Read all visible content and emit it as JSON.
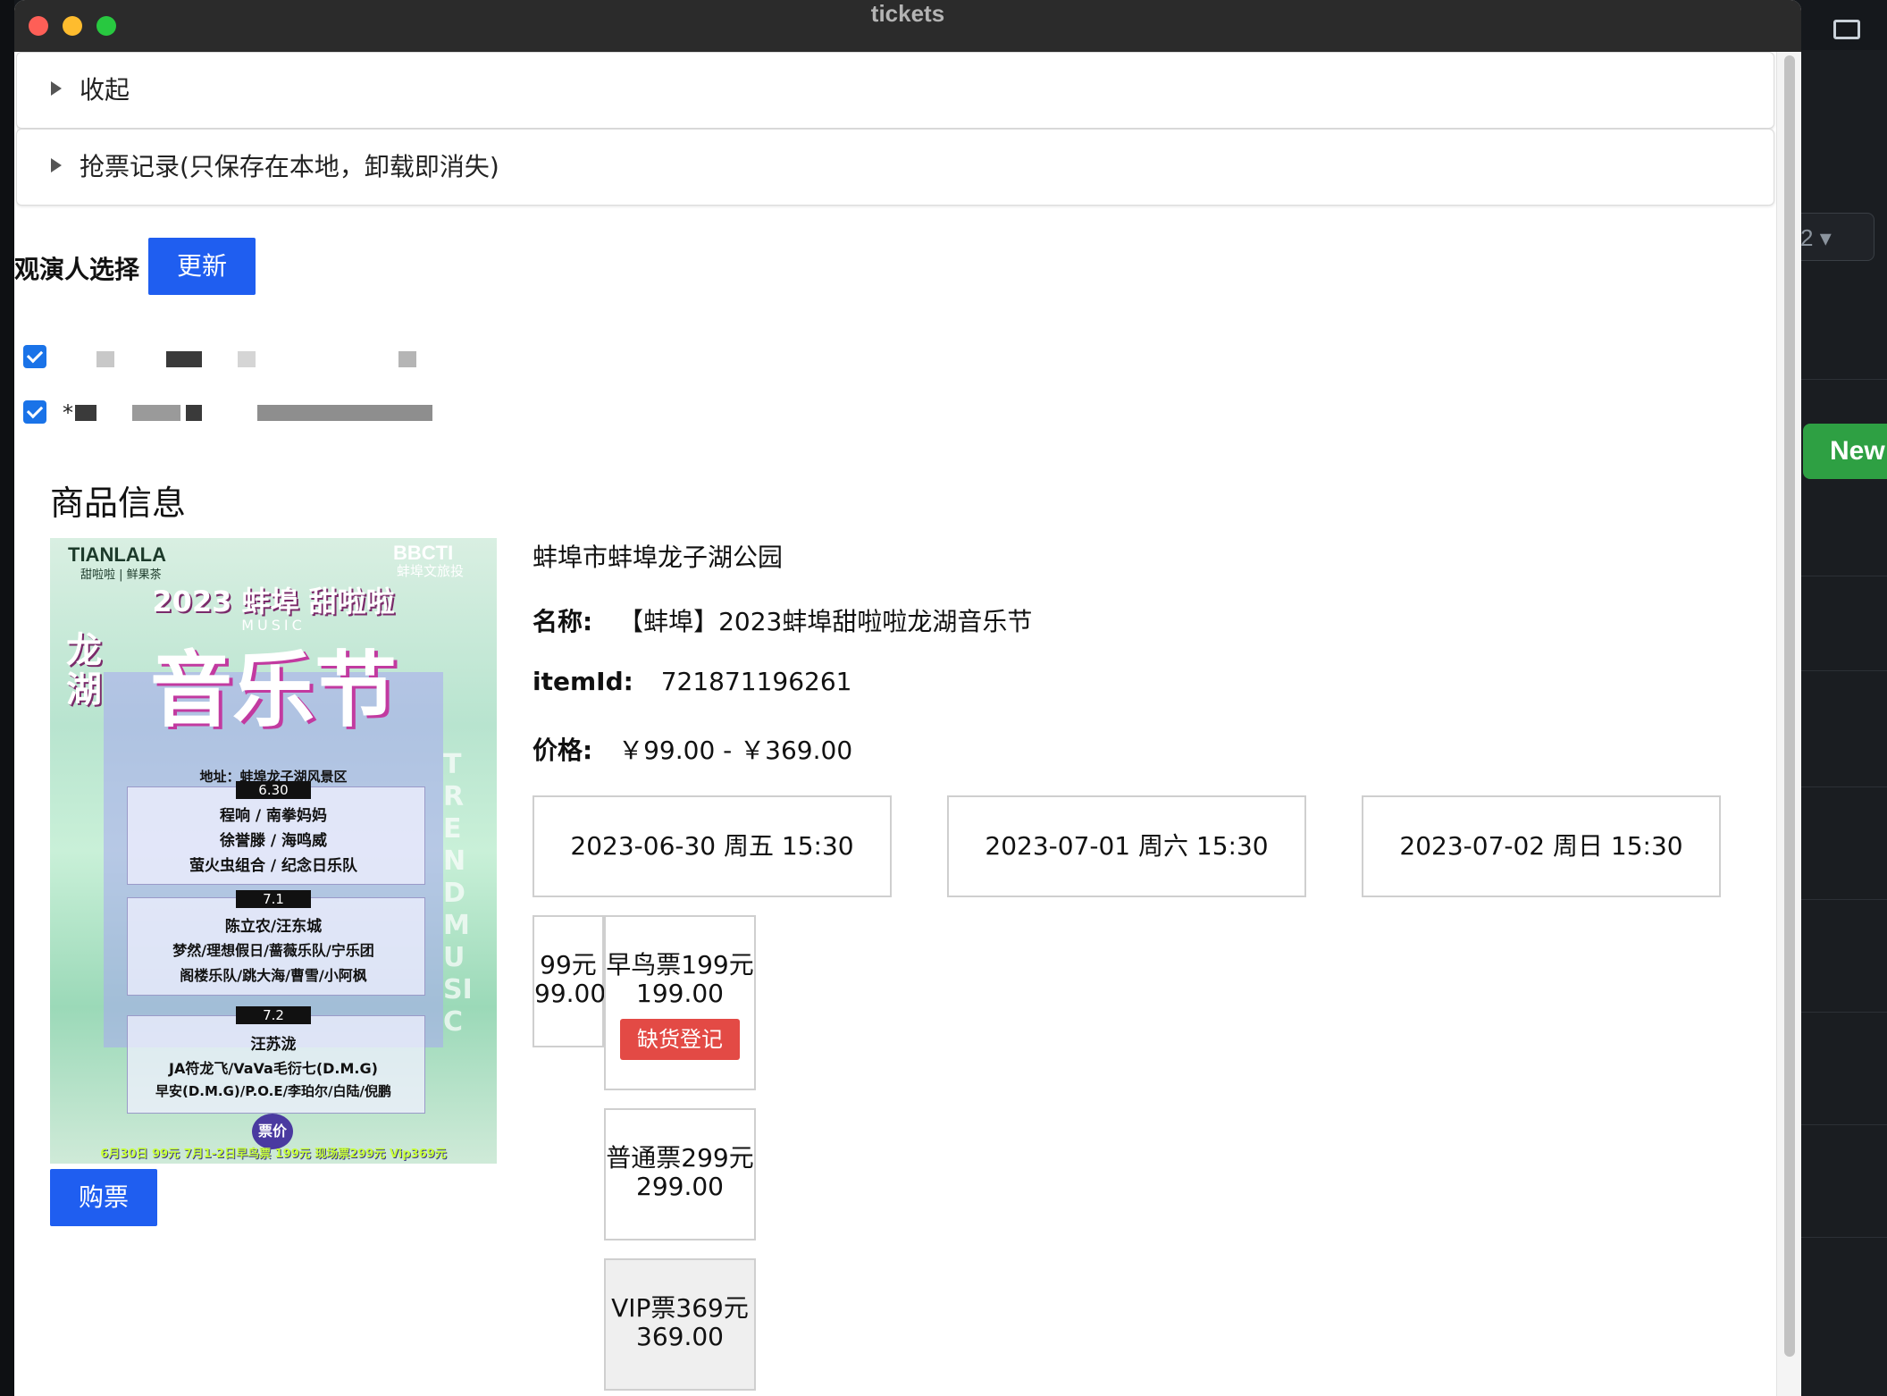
{
  "window": {
    "title": "tickets"
  },
  "background": {
    "new_button": "New",
    "dropdown_value": "2"
  },
  "details": [
    {
      "label": "收起"
    },
    {
      "label": "抢票记录(只保存在本地，卸载即消失)"
    }
  ],
  "audience": {
    "label": "观演人选择",
    "update_button": "更新",
    "checkboxes": [
      {
        "checked": true,
        "prefix": ""
      },
      {
        "checked": true,
        "prefix": "*"
      }
    ]
  },
  "goods": {
    "heading": "商品信息",
    "venue": "蚌埠市蚌埠龙子湖公园",
    "name_label": "名称:",
    "name_value": "【蚌埠】2023蚌埠甜啦啦龙湖音乐节",
    "itemid_label": "itemId:",
    "itemid_value": "721871196261",
    "price_label": "价格:",
    "price_value": "￥99.00 - ￥369.00",
    "buy_button": "购票"
  },
  "poster": {
    "brand_left": "TIANLALA",
    "brand_left_sub": "甜啦啦 | 鲜果茶",
    "brand_right": "BBCTI",
    "brand_right_sub": "蚌埠文旅投",
    "year_title": "2023 蚌埠 甜啦啦",
    "music": "MUSIC",
    "side_title": "龙湖",
    "big_title": "音乐节",
    "address": "地址：蚌埠龙子湖风景区",
    "day1": "6.30",
    "day1_l1": "程响 / 南拳妈妈",
    "day1_l2": "徐誉滕 / 海鸣威",
    "day1_l3": "萤火虫组合 / 纪念日乐队",
    "day2": "7.1",
    "day2_l1": "陈立农/汪东城",
    "day2_l2": "梦然/理想假日/蔷薇乐队/宁乐团",
    "day2_l3": "阁楼乐队/跳大海/曹雪/小阿枫",
    "day3": "7.2",
    "day3_l1": "汪苏泷",
    "day3_l2": "JA符龙飞/VaVa毛衍七(D.M.G)",
    "day3_l3": "早安(D.M.G)/P.O.E/李珀尔/白陆/倪鹏",
    "price_badge": "票价",
    "footer": "6月30日 99元 7月1-2日早鸟票 199元 现场票299元 Vip369元",
    "side_vertical": "TREND MUSIC"
  },
  "dates": [
    "2023-06-30 周五 15:30",
    "2023-07-01 周六 15:30",
    "2023-07-02 周日 15:30"
  ],
  "tiers": [
    {
      "name": "99元",
      "price": "99.00"
    },
    {
      "name": "早鸟票199元",
      "price": "199.00",
      "action": "缺货登记"
    },
    {
      "name": "普通票299元",
      "price": "299.00"
    },
    {
      "name": "VIP票369元",
      "price": "369.00"
    }
  ]
}
